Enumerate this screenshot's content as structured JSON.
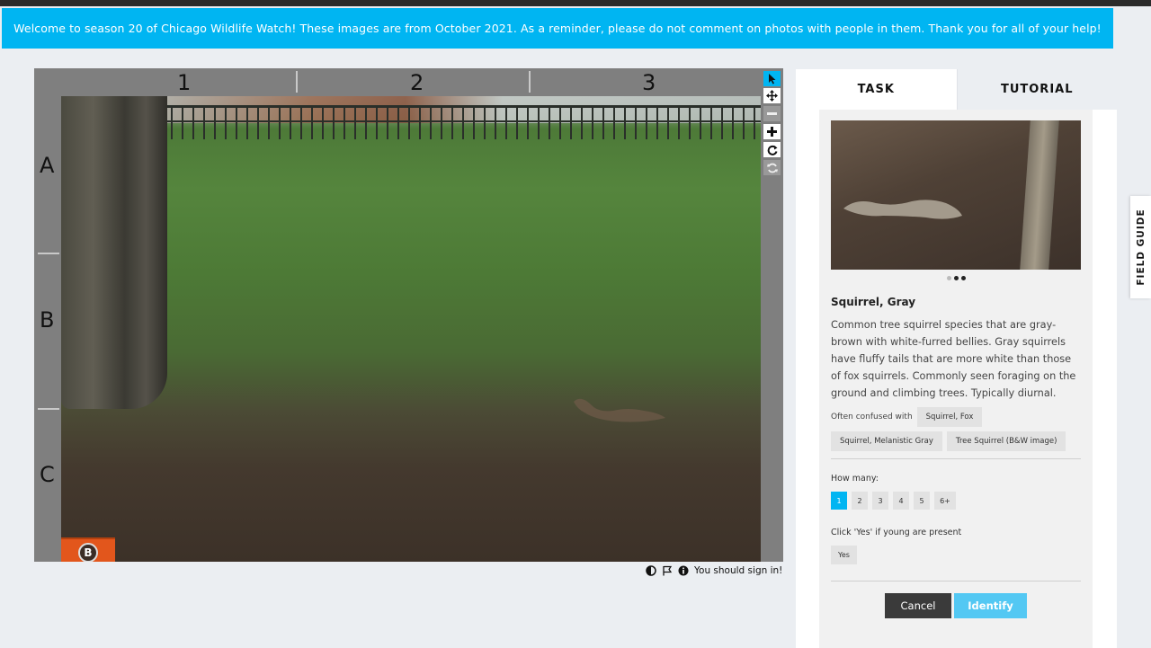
{
  "banner": {
    "text": "Welcome to season 20 of Chicago Wildlife Watch! These images are from October 2021. As a reminder, please do not comment on photos with people in them. Thank you for all of your help!"
  },
  "viewer": {
    "columns": [
      "1",
      "2",
      "3"
    ],
    "rows": [
      "A",
      "B",
      "C"
    ],
    "logo_letter": "B",
    "toolbar_icons": [
      "pointer-icon",
      "move-icon",
      "zoom-out-icon",
      "zoom-in-icon",
      "rotate-icon",
      "reset-icon"
    ]
  },
  "meta": {
    "signin_text": "You should sign in!"
  },
  "panel": {
    "tabs": [
      {
        "label": "TASK",
        "active": true
      },
      {
        "label": "TUTORIAL",
        "active": false
      }
    ],
    "carousel": {
      "count": 3,
      "active": 1
    },
    "species": {
      "name": "Squirrel, Gray",
      "description": "Common tree squirrel species that are gray-brown with white-furred bellies. Gray squirrels have fluffy tails that are more white than those of fox squirrels. Commonly seen foraging on the ground and climbing trees. Typically diurnal.",
      "confused_label": "Often confused with",
      "confused_with": [
        "Squirrel, Fox",
        "Squirrel, Melanistic Gray",
        "Tree Squirrel (B&W image)"
      ]
    },
    "how_many": {
      "label": "How many:",
      "options": [
        "1",
        "2",
        "3",
        "4",
        "5",
        "6+"
      ],
      "selected": "1"
    },
    "young": {
      "label": "Click 'Yes' if young are present",
      "yes_label": "Yes"
    },
    "buttons": {
      "cancel": "Cancel",
      "identify": "Identify"
    }
  },
  "field_guide": {
    "label": "FIELD GUIDE"
  },
  "colors": {
    "accent": "#00b5f2",
    "identify": "#53c8f3",
    "cancel": "#3a3a3a"
  }
}
